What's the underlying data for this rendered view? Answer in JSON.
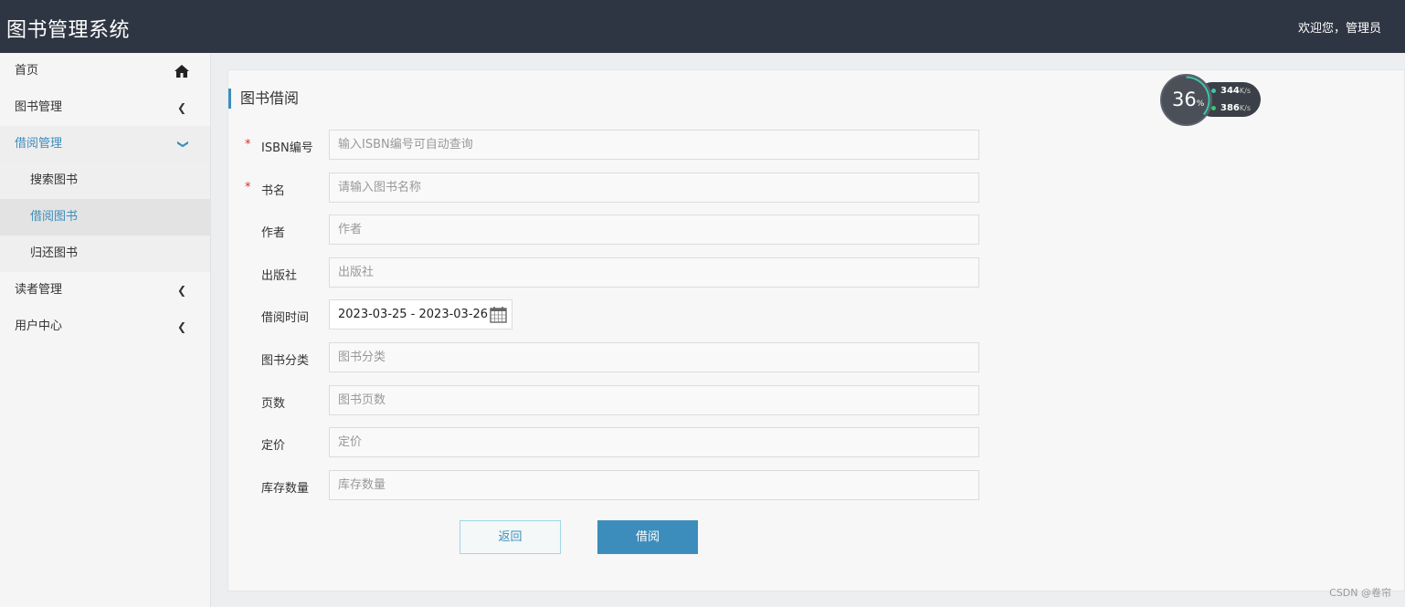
{
  "header": {
    "app_title": "图书管理系统",
    "welcome": "欢迎您，管理员"
  },
  "sidebar": {
    "items": [
      {
        "label": "首页",
        "icon": "home-icon"
      },
      {
        "label": "图书管理",
        "icon": "chevron-left-icon"
      },
      {
        "label": "借阅管理",
        "icon": "chevron-down-icon",
        "state": "expanded"
      },
      {
        "label": "搜索图书"
      },
      {
        "label": "借阅图书",
        "state": "active"
      },
      {
        "label": "归还图书"
      },
      {
        "label": "读者管理",
        "icon": "chevron-left-icon"
      },
      {
        "label": "用户中心",
        "icon": "chevron-left-icon"
      }
    ]
  },
  "form": {
    "title": "图书借阅",
    "fields": [
      {
        "label": "ISBN编号",
        "placeholder": "输入ISBN编号可自动查询",
        "required": true
      },
      {
        "label": "书名",
        "placeholder": "请输入图书名称",
        "required": true
      },
      {
        "label": "作者",
        "placeholder": "作者"
      },
      {
        "label": "出版社",
        "placeholder": "出版社"
      },
      {
        "label": "借阅时间",
        "value": "2023-03-25 - 2023-03-26"
      },
      {
        "label": "图书分类",
        "placeholder": "图书分类"
      },
      {
        "label": "页数",
        "placeholder": "图书页数"
      },
      {
        "label": "定价",
        "placeholder": "定价"
      },
      {
        "label": "库存数量",
        "placeholder": "库存数量"
      }
    ],
    "required_mark": "*",
    "back_label": "返回",
    "submit_label": "借阅"
  },
  "net_widget": {
    "percent": "36",
    "percent_unit": "%",
    "upload": "344",
    "download": "386",
    "unit": "K/s"
  },
  "watermark": "CSDN @卷帘",
  "colors": {
    "topbar": "#2f3643",
    "accent": "#3c8dbc",
    "required": "#d93025"
  }
}
